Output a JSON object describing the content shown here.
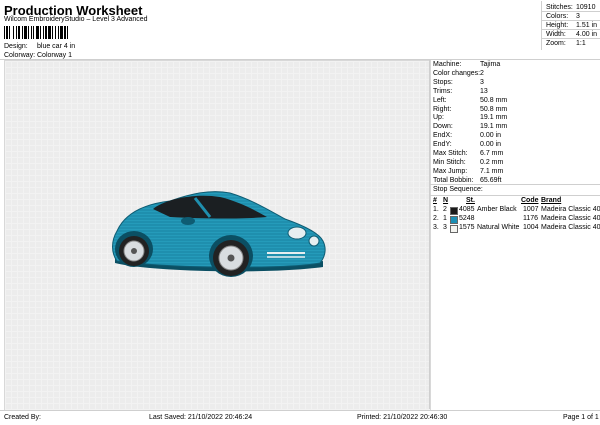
{
  "header": {
    "title": "Production Worksheet",
    "subtitle": "Wilcom EmbroideryStudio – Level 3 Advanced",
    "design_label": "Design:",
    "design_value": "blue car 4 in",
    "colorway_label": "Colorway:",
    "colorway_value": "Colorway 1"
  },
  "stats": [
    {
      "label": "Stitches:",
      "value": "10910"
    },
    {
      "label": "Colors:",
      "value": "3"
    },
    {
      "label": "Height:",
      "value": "1.51 in"
    },
    {
      "label": "Width:",
      "value": "4.00 in"
    },
    {
      "label": "Zoom:",
      "value": "1:1"
    }
  ],
  "machine_info": [
    {
      "label": "Machine:",
      "value": "Tajima"
    },
    {
      "label": "Color changes:",
      "value": "2"
    },
    {
      "label": "Stops:",
      "value": "3"
    },
    {
      "label": "Trims:",
      "value": "13"
    },
    {
      "label": "Left:",
      "value": "50.8 mm"
    },
    {
      "label": "Right:",
      "value": "50.8 mm"
    },
    {
      "label": "Up:",
      "value": "19.1 mm"
    },
    {
      "label": "Down:",
      "value": "19.1 mm"
    },
    {
      "label": "EndX:",
      "value": "0.00 in"
    },
    {
      "label": "EndY:",
      "value": "0.00 in"
    },
    {
      "label": "Max Stitch:",
      "value": "6.7 mm"
    },
    {
      "label": "Min Stitch:",
      "value": "0.2 mm"
    },
    {
      "label": "Max Jump:",
      "value": "7.1 mm"
    },
    {
      "label": "Total Bobbin:",
      "value": "65.69ft"
    }
  ],
  "stop_sequence": {
    "title": "Stop Sequence:",
    "headers": {
      "num": "#",
      "n": "N",
      "st": "St.",
      "code": "Code",
      "brand": "Brand"
    },
    "rows": [
      {
        "num": "1.",
        "n": "2",
        "color": "#1a1a1a",
        "st": "4085",
        "name": "Amber Black",
        "code": "1007",
        "brand": "Madeira Classic 40"
      },
      {
        "num": "2.",
        "n": "1",
        "color": "#1a8fb5",
        "st": "5248",
        "name": "",
        "code": "1176",
        "brand": "Madeira Classic 40"
      },
      {
        "num": "3.",
        "n": "3",
        "color": "#f4f4f0",
        "st": "1575",
        "name": "Natural White",
        "code": "1004",
        "brand": "Madeira Classic 40"
      }
    ]
  },
  "footer": {
    "created_by": "Created By:",
    "last_saved": "Last Saved: 21/10/2022 20:46:24",
    "printed": "Printed: 21/10/2022 20:46:30",
    "page": "Page 1 of 1"
  },
  "colors": {
    "car_body": "#1f8fae",
    "car_dark": "#0e5c73",
    "window": "#1b1f22"
  }
}
